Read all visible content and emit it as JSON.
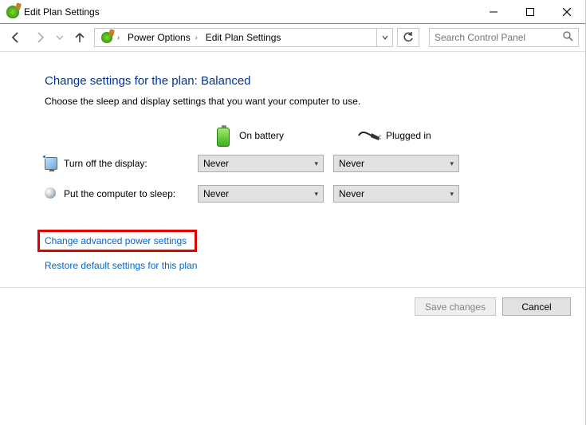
{
  "window": {
    "title": "Edit Plan Settings"
  },
  "breadcrumb": {
    "items": [
      {
        "label": "Power Options"
      },
      {
        "label": "Edit Plan Settings"
      }
    ]
  },
  "search": {
    "placeholder": "Search Control Panel"
  },
  "page": {
    "heading": "Change settings for the plan: Balanced",
    "sub": "Choose the sleep and display settings that you want your computer to use."
  },
  "columns": {
    "battery": "On battery",
    "plugged": "Plugged in"
  },
  "settings": [
    {
      "icon": "display",
      "label": "Turn off the display:",
      "battery_value": "Never",
      "plugged_value": "Never"
    },
    {
      "icon": "sleep",
      "label": "Put the computer to sleep:",
      "battery_value": "Never",
      "plugged_value": "Never"
    }
  ],
  "links": {
    "advanced": "Change advanced power settings",
    "restore": "Restore default settings for this plan"
  },
  "buttons": {
    "save": "Save changes",
    "cancel": "Cancel"
  }
}
